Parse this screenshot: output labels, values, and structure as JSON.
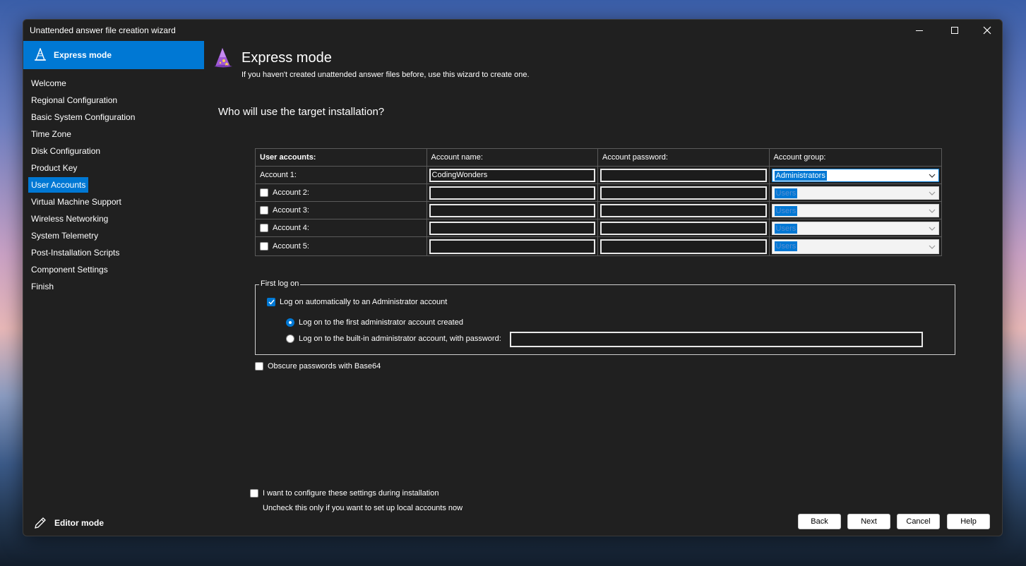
{
  "window": {
    "title": "Unattended answer file creation wizard"
  },
  "sidebar": {
    "header_label": "Express mode",
    "items": [
      {
        "label": "Welcome"
      },
      {
        "label": "Regional Configuration"
      },
      {
        "label": "Basic System Configuration"
      },
      {
        "label": "Time Zone"
      },
      {
        "label": "Disk Configuration"
      },
      {
        "label": "Product Key"
      },
      {
        "label": "User Accounts",
        "active": true
      },
      {
        "label": "Virtual Machine Support"
      },
      {
        "label": "Wireless Networking"
      },
      {
        "label": "System Telemetry"
      },
      {
        "label": "Post-Installation Scripts"
      },
      {
        "label": "Component Settings"
      },
      {
        "label": "Finish"
      }
    ],
    "editor_mode_label": "Editor mode"
  },
  "header": {
    "title": "Express mode",
    "subtitle": "If you haven't created unattended answer files before, use this wizard to create one."
  },
  "question": "Who will use the target installation?",
  "accounts_table": {
    "headers": [
      "User accounts:",
      "Account name:",
      "Account password:",
      "Account group:"
    ],
    "rows": [
      {
        "label": "Account 1:",
        "has_checkbox": false,
        "checked": true,
        "name": "CodingWonders",
        "password": "",
        "group": "Administrators",
        "enabled": true
      },
      {
        "label": "Account 2:",
        "has_checkbox": true,
        "checked": false,
        "name": "",
        "password": "",
        "group": "Users",
        "enabled": false
      },
      {
        "label": "Account 3:",
        "has_checkbox": true,
        "checked": false,
        "name": "",
        "password": "",
        "group": "Users",
        "enabled": false
      },
      {
        "label": "Account 4:",
        "has_checkbox": true,
        "checked": false,
        "name": "",
        "password": "",
        "group": "Users",
        "enabled": false
      },
      {
        "label": "Account 5:",
        "has_checkbox": true,
        "checked": false,
        "name": "",
        "password": "",
        "group": "Users",
        "enabled": false
      }
    ]
  },
  "first_logon": {
    "group_label": "First log on",
    "auto_logon_label": "Log on automatically to an Administrator account",
    "auto_logon_checked": true,
    "option_first_admin": "Log on to the first administrator account created",
    "option_builtin_admin": "Log on to the built-in administrator account, with password:",
    "selected_option": "first_admin",
    "builtin_password": ""
  },
  "obscure_passwords": {
    "label": "Obscure passwords with Base64",
    "checked": false
  },
  "configure_during_install": {
    "label": "I want to configure these settings during installation",
    "hint": "Uncheck this only if you want to set up local accounts now",
    "checked": false
  },
  "buttons": {
    "back": "Back",
    "next": "Next",
    "cancel": "Cancel",
    "help": "Help"
  },
  "colors": {
    "accent": "#0078d4",
    "window_bg": "#202020",
    "text": "#ffffff"
  }
}
